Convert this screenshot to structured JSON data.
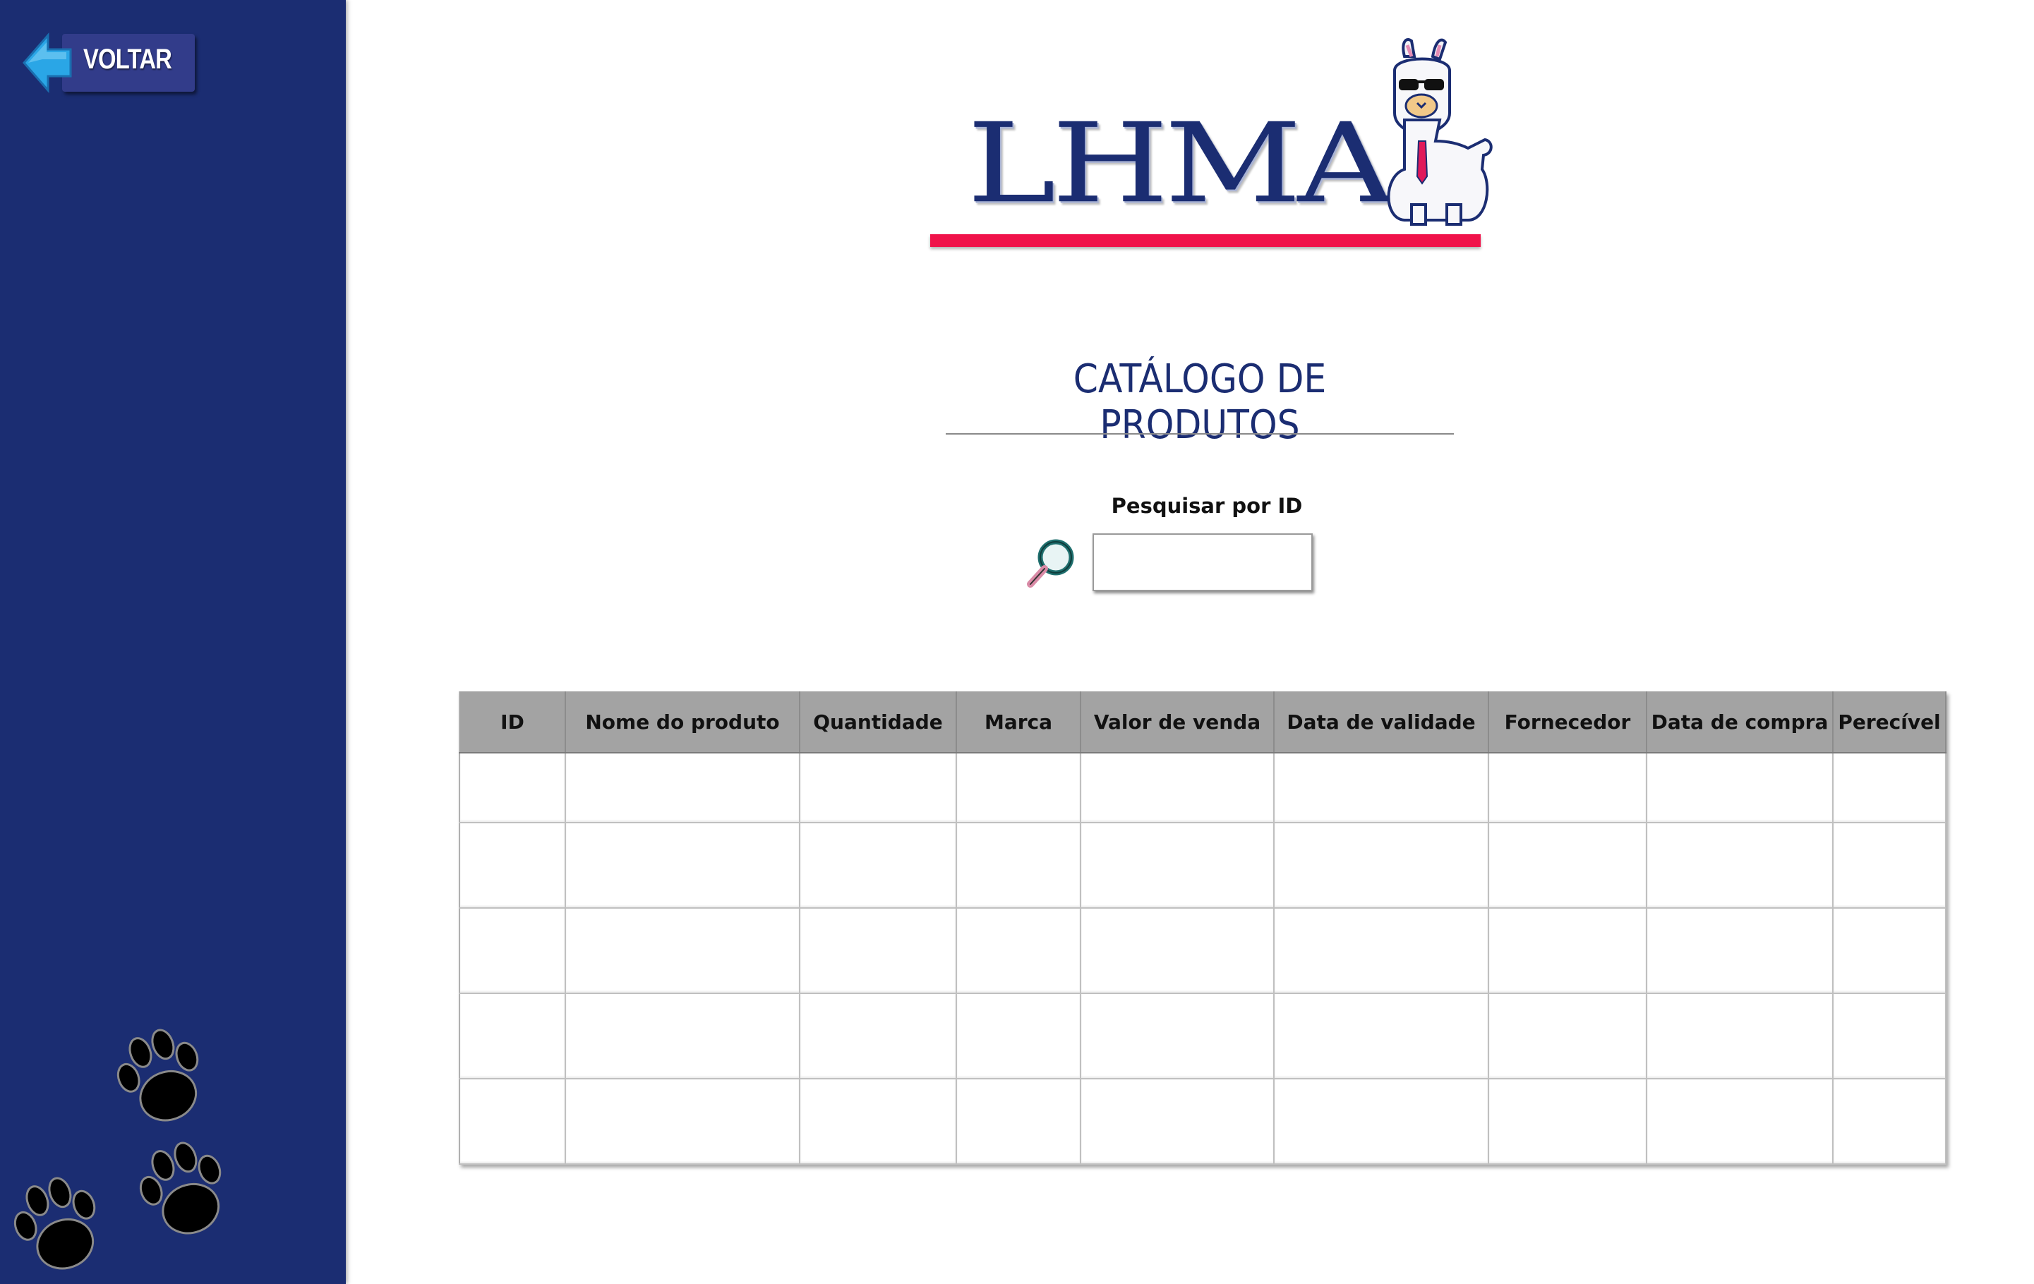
{
  "sidebar": {
    "back_label": "VOLTAR",
    "color": "#1b2d72"
  },
  "logo": {
    "text": "LHMA",
    "bar_color": "#f0134a"
  },
  "page_title": "CATÁLOGO DE PRODUTOS",
  "search": {
    "label": "Pesquisar por ID",
    "value": "",
    "placeholder": ""
  },
  "table": {
    "columns": [
      "ID",
      "Nome do produto",
      "Quantidade",
      "Marca",
      "Valor de venda",
      "Data de validade",
      "Fornecedor",
      "Data de compra",
      "Perecível"
    ],
    "rows": [
      [
        "",
        "",
        "",
        "",
        "",
        "",
        "",
        "",
        ""
      ],
      [
        "",
        "",
        "",
        "",
        "",
        "",
        "",
        "",
        ""
      ],
      [
        "",
        "",
        "",
        "",
        "",
        "",
        "",
        "",
        ""
      ],
      [
        "",
        "",
        "",
        "",
        "",
        "",
        "",
        "",
        ""
      ],
      [
        "",
        "",
        "",
        "",
        "",
        "",
        "",
        "",
        ""
      ]
    ]
  },
  "icons": {
    "back": "arrow-left-icon",
    "search": "magnifier-icon",
    "mascot": "llama-mascot",
    "decor": "paw-print-icon"
  }
}
